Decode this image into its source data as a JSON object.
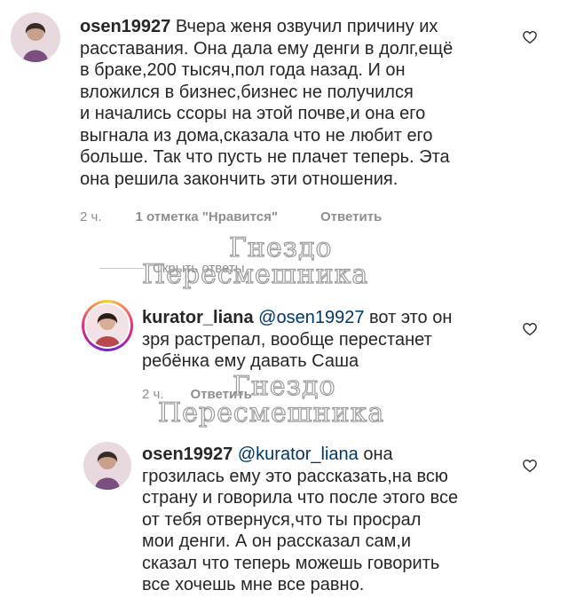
{
  "comments": [
    {
      "username": "osen19927",
      "mention": "",
      "text": " Вчера женя озвучил причину их\nрасставания. Она дала ему денги в долг,ещё\nв браке,200 тысяч,пол года назад. И он\nвложился в бизнес,бизнес не получился\nи начались ссоры на этой почве,и она его\nвыгнала из дома,сказала что не любит его\nбольше. Так что пусть не плачет теперь.  Эта\nона решила закончить эти отношения.",
      "time": "2 ч.",
      "likes": "1 отметка \"Нравится\"",
      "reply": "Ответить"
    },
    {
      "username": "kurator_liana",
      "mention": "@osen19927",
      "text": " вот это он\nзря растрепал, вообще перестанет\nребёнка ему давать Саша",
      "time": "2 ч.",
      "likes": "",
      "reply": "Ответить"
    },
    {
      "username": "osen19927",
      "mention": "@kurator_liana",
      "text": " она\nгрозилась ему это рассказать,на всю\nстрану и говорила что после этого все\nот тебя отвернуся,что ты просрал\nмои денги. А он рассказал сам,и\nсказал что теперь можешь говорить\nвсе хочешь мне все равно.",
      "time": "",
      "likes": "",
      "reply": ""
    }
  ],
  "hide_replies": "Скрыть ответы",
  "watermark": {
    "line1": "Гнездо",
    "line2": "Пересмешника"
  },
  "icons": {
    "like": "heart-outline-icon",
    "avatar": "user-avatar"
  },
  "colors": {
    "text": "#262626",
    "meta": "#8e8e8e",
    "mention": "#00376b"
  }
}
